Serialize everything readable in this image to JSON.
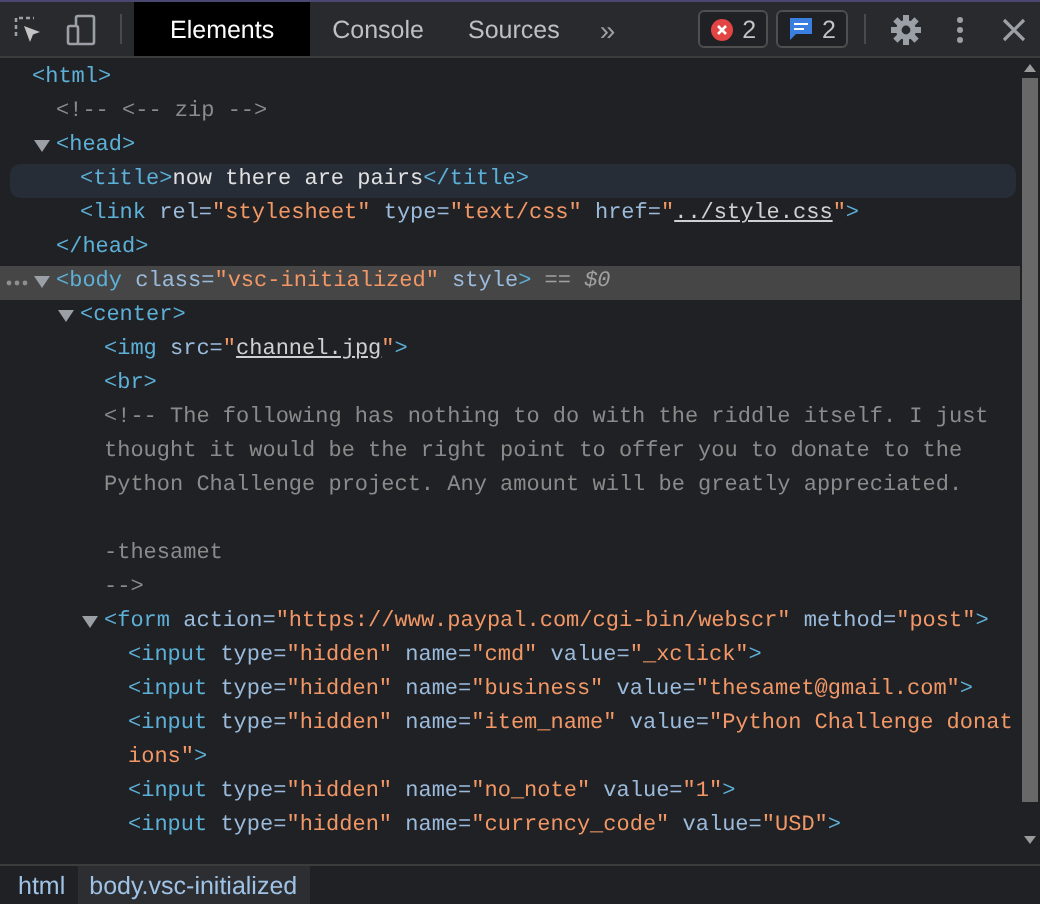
{
  "toolbar": {
    "tabs": [
      {
        "label": "Elements",
        "selected": true
      },
      {
        "label": "Console",
        "selected": false
      },
      {
        "label": "Sources",
        "selected": false
      }
    ],
    "more_tabs": "»",
    "issues": [
      {
        "kind": "error",
        "count": "2"
      },
      {
        "kind": "message",
        "count": "2"
      }
    ]
  },
  "dom_tree": [
    {
      "segments": [
        {
          "kind": "tag",
          "text": "<html>"
        }
      ],
      "selected": false,
      "hovered": false,
      "children": [
        {
          "segments": [
            {
              "kind": "comment",
              "text": "<!-- <-- zip -->"
            }
          ],
          "selected": false,
          "hovered": false
        },
        {
          "segments": [
            {
              "kind": "tag",
              "text": "<head>"
            }
          ],
          "expanded": true,
          "selected": false,
          "hovered": false,
          "closing": [
            {
              "kind": "tag",
              "text": "</head>"
            }
          ],
          "children": [
            {
              "segments": [
                {
                  "kind": "tag",
                  "text": "<title>"
                },
                {
                  "kind": "text",
                  "text": "now there are pairs"
                },
                {
                  "kind": "tag",
                  "text": "</title>"
                }
              ],
              "selected": false,
              "hovered": true
            },
            {
              "segments": [
                {
                  "kind": "tag",
                  "text": "<link"
                },
                {
                  "kind": "attr",
                  "text": " rel="
                },
                {
                  "kind": "value",
                  "text": "\"stylesheet\""
                },
                {
                  "kind": "attr",
                  "text": " type="
                },
                {
                  "kind": "value",
                  "text": "\"text/css\""
                },
                {
                  "kind": "attr",
                  "text": " href="
                },
                {
                  "kind": "value",
                  "text": "\""
                },
                {
                  "kind": "link",
                  "text": "../style.css"
                },
                {
                  "kind": "value",
                  "text": "\""
                },
                {
                  "kind": "tag",
                  "text": ">"
                }
              ],
              "selected": false,
              "hovered": false
            }
          ]
        },
        {
          "segments": [
            {
              "kind": "tag",
              "text": "<body"
            },
            {
              "kind": "attr",
              "text": " class="
            },
            {
              "kind": "value",
              "text": "\"vsc-initialized\""
            },
            {
              "kind": "attr",
              "text": " style"
            },
            {
              "kind": "tag",
              "text": ">"
            },
            {
              "kind": "ref",
              "text": " == $0"
            }
          ],
          "expanded": true,
          "selected": true,
          "hovered": false,
          "children": [
            {
              "segments": [
                {
                  "kind": "tag",
                  "text": "<center>"
                }
              ],
              "expanded": true,
              "selected": false,
              "hovered": false,
              "children": [
                {
                  "segments": [
                    {
                      "kind": "tag",
                      "text": "<img"
                    },
                    {
                      "kind": "attr",
                      "text": " src="
                    },
                    {
                      "kind": "value",
                      "text": "\""
                    },
                    {
                      "kind": "link",
                      "text": "channel.jpg"
                    },
                    {
                      "kind": "value",
                      "text": "\""
                    },
                    {
                      "kind": "tag",
                      "text": ">"
                    }
                  ],
                  "selected": false,
                  "hovered": false
                },
                {
                  "segments": [
                    {
                      "kind": "tag",
                      "text": "<br>"
                    }
                  ],
                  "selected": false,
                  "hovered": false
                },
                {
                  "segments": [
                    {
                      "kind": "comment",
                      "text": "<!-- The following has nothing to do with the riddle itself. I just\nthought it would be the right point to offer you to donate to the\nPython Challenge project. Any amount will be greatly appreciated.\n\n-thesamet\n-->"
                    }
                  ],
                  "selected": false,
                  "hovered": false
                },
                {
                  "segments": [
                    {
                      "kind": "tag",
                      "text": "<form"
                    },
                    {
                      "kind": "attr",
                      "text": " action="
                    },
                    {
                      "kind": "value",
                      "text": "\"https://www.paypal.com/cgi-bin/webscr\""
                    },
                    {
                      "kind": "attr",
                      "text": " method="
                    },
                    {
                      "kind": "value",
                      "text": "\"post\""
                    },
                    {
                      "kind": "tag",
                      "text": ">"
                    }
                  ],
                  "expanded": true,
                  "selected": false,
                  "hovered": false,
                  "children": [
                    {
                      "segments": [
                        {
                          "kind": "tag",
                          "text": "<input"
                        },
                        {
                          "kind": "attr",
                          "text": " type="
                        },
                        {
                          "kind": "value",
                          "text": "\"hidden\""
                        },
                        {
                          "kind": "attr",
                          "text": " name="
                        },
                        {
                          "kind": "value",
                          "text": "\"cmd\""
                        },
                        {
                          "kind": "attr",
                          "text": " value="
                        },
                        {
                          "kind": "value",
                          "text": "\"_xclick\""
                        },
                        {
                          "kind": "tag",
                          "text": ">"
                        }
                      ],
                      "selected": false,
                      "hovered": false
                    },
                    {
                      "segments": [
                        {
                          "kind": "tag",
                          "text": "<input"
                        },
                        {
                          "kind": "attr",
                          "text": " type="
                        },
                        {
                          "kind": "value",
                          "text": "\"hidden\""
                        },
                        {
                          "kind": "attr",
                          "text": " name="
                        },
                        {
                          "kind": "value",
                          "text": "\"business\""
                        },
                        {
                          "kind": "attr",
                          "text": " value="
                        },
                        {
                          "kind": "value",
                          "text": "\"thesamet@gmail.com\""
                        },
                        {
                          "kind": "tag",
                          "text": ">"
                        }
                      ],
                      "selected": false,
                      "hovered": false
                    },
                    {
                      "segments": [
                        {
                          "kind": "tag",
                          "text": "<input"
                        },
                        {
                          "kind": "attr",
                          "text": " type="
                        },
                        {
                          "kind": "value",
                          "text": "\"hidden\""
                        },
                        {
                          "kind": "attr",
                          "text": " name="
                        },
                        {
                          "kind": "value",
                          "text": "\"item_name\""
                        },
                        {
                          "kind": "attr",
                          "text": " value="
                        },
                        {
                          "kind": "value",
                          "text": "\"Python Challenge donations\""
                        },
                        {
                          "kind": "tag",
                          "text": ">"
                        }
                      ],
                      "selected": false,
                      "hovered": false
                    },
                    {
                      "segments": [
                        {
                          "kind": "tag",
                          "text": "<input"
                        },
                        {
                          "kind": "attr",
                          "text": " type="
                        },
                        {
                          "kind": "value",
                          "text": "\"hidden\""
                        },
                        {
                          "kind": "attr",
                          "text": " name="
                        },
                        {
                          "kind": "value",
                          "text": "\"no_note\""
                        },
                        {
                          "kind": "attr",
                          "text": " value="
                        },
                        {
                          "kind": "value",
                          "text": "\"1\""
                        },
                        {
                          "kind": "tag",
                          "text": ">"
                        }
                      ],
                      "selected": false,
                      "hovered": false
                    },
                    {
                      "segments": [
                        {
                          "kind": "tag",
                          "text": "<input"
                        },
                        {
                          "kind": "attr",
                          "text": " type="
                        },
                        {
                          "kind": "value",
                          "text": "\"hidden\""
                        },
                        {
                          "kind": "attr",
                          "text": " name="
                        },
                        {
                          "kind": "value",
                          "text": "\"currency_code\""
                        },
                        {
                          "kind": "attr",
                          "text": " value="
                        },
                        {
                          "kind": "value",
                          "text": "\"USD\""
                        },
                        {
                          "kind": "tag",
                          "text": ">"
                        }
                      ],
                      "selected": false,
                      "hovered": false
                    }
                  ]
                }
              ]
            }
          ]
        }
      ]
    }
  ],
  "breadcrumbs": [
    {
      "label": "html",
      "selected": false
    },
    {
      "label": "body.vsc-initialized",
      "selected": true
    }
  ]
}
